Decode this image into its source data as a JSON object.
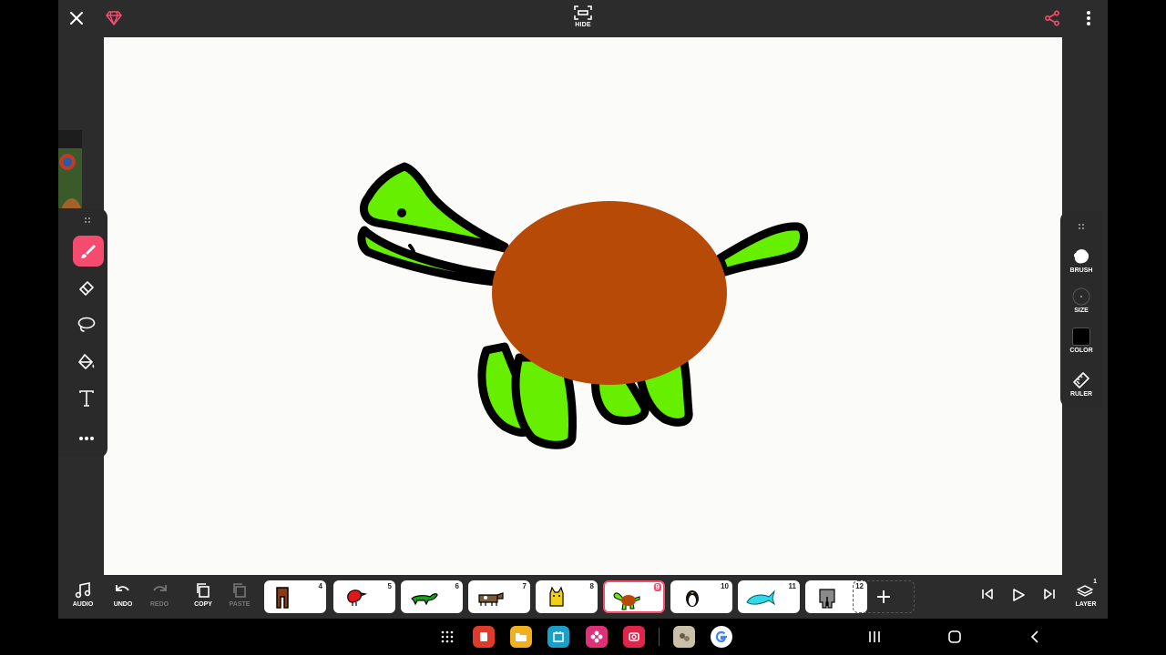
{
  "topbar": {
    "hide_label": "HIDE"
  },
  "right_panel": {
    "brush_label": "BRUSH",
    "size_label": "SIZE",
    "color_label": "COLOR",
    "ruler_label": "RULER",
    "current_color": "#000000"
  },
  "bottombar": {
    "audio_label": "AUDIO",
    "undo_label": "UNDO",
    "redo_label": "REDO",
    "copy_label": "COPY",
    "paste_label": "PASTE",
    "layer_label": "LAYER",
    "layer_count": "1",
    "frames": [
      {
        "number": "4",
        "subject": "brown-figure",
        "selected": false
      },
      {
        "number": "5",
        "subject": "red-bird",
        "selected": false
      },
      {
        "number": "6",
        "subject": "green-lizard",
        "selected": false
      },
      {
        "number": "7",
        "subject": "brown-cow",
        "selected": false
      },
      {
        "number": "8",
        "subject": "yellow-cat",
        "selected": false
      },
      {
        "number": "9",
        "subject": "turtle",
        "selected": true
      },
      {
        "number": "10",
        "subject": "penguin",
        "selected": false
      },
      {
        "number": "11",
        "subject": "cyan-fish",
        "selected": false
      },
      {
        "number": "12",
        "subject": "gray-elephant",
        "selected": false
      }
    ]
  },
  "colors": {
    "accent": "#f44b6e",
    "turtle_green": "#66f000",
    "turtle_shell": "#b84a08"
  }
}
